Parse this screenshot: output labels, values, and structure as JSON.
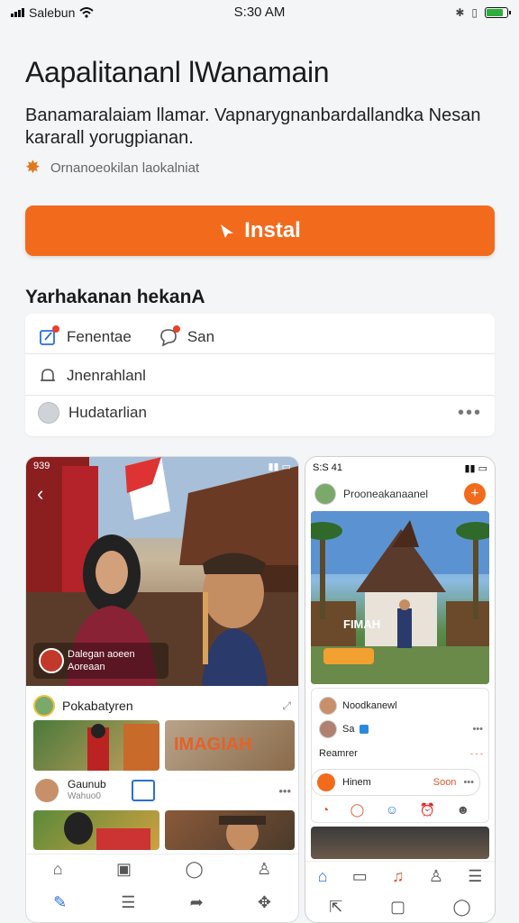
{
  "status_bar": {
    "carrier": "Salebun",
    "time": "S:30 AM"
  },
  "app": {
    "title": "Aapalitananl lWanamain",
    "description": "Banamaralaiam llamar. Vapnarygnanbardallandka Nesan kararall yorugpianan.",
    "meta": "Ornanoeokilan laokalniat",
    "install_label": "Instal"
  },
  "section": {
    "title": "Yarhakanan hekanA"
  },
  "info_card": {
    "item1_label": "Fenentae",
    "item2_label": "San",
    "row2_label": "Jnenrahlanl",
    "row3_label": "Hudatarlian",
    "more": "•••"
  },
  "screenshot_a": {
    "time": "939",
    "caption": "Dalegan aoeen Aoreaan",
    "feed_title": "Pokabatyren",
    "sign_text": "IMAGIAH",
    "sub_name": "Gaunub",
    "sub_detail": "Wahuo0"
  },
  "screenshot_b": {
    "time": "S:S 41",
    "header_title": "Prooneakanaanel",
    "plus": "+",
    "banner_text": "FIMAH",
    "row1": "Noodkanewl",
    "row2": "Sa",
    "row3": "Reamrer",
    "chip_title": "Hinem",
    "chip_value": "Soon",
    "row3_value": "- - -"
  },
  "icons": {
    "signal": "signal-icon",
    "wifi": "wifi-icon",
    "battery": "battery-icon",
    "star": "star-icon",
    "install": "install-icon",
    "edit": "edit-icon",
    "chat": "chat-icon",
    "bell": "bell-icon",
    "avatar": "avatar-icon",
    "more": "more-icon",
    "home": "home-icon",
    "search": "search-icon",
    "user": "user-icon",
    "menu": "menu-icon"
  },
  "colors": {
    "accent": "#f26b1d",
    "background": "#f4f5f7",
    "badge": "#e8412c"
  }
}
